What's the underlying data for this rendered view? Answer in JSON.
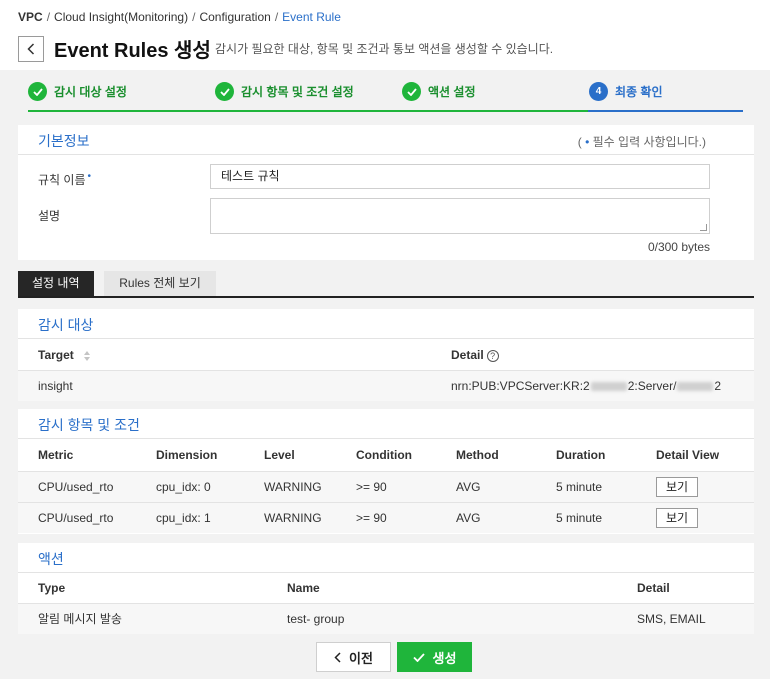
{
  "breadcrumb": {
    "items": [
      "VPC",
      "Cloud Insight(Monitoring)",
      "Configuration",
      "Event Rule"
    ],
    "separator": "/"
  },
  "header": {
    "title": "Event Rules 생성",
    "description": "감시가 필요한 대상, 항목 및 조건과 통보 액션을 생성할 수 있습니다."
  },
  "steps": [
    {
      "label": "감시 대상 설정",
      "state": "done"
    },
    {
      "label": "감시 항목 및 조건 설정",
      "state": "done"
    },
    {
      "label": "액션 설정",
      "state": "done"
    },
    {
      "label": "최종 확인",
      "state": "current",
      "number": "4"
    }
  ],
  "basic_info": {
    "title": "기본정보",
    "required_note_open": "(",
    "required_note_dot": "•",
    "required_note_text": "필수 입력 사항입니다.)",
    "name_label": "규칙 이름",
    "required_marker": "•",
    "name_value": "테스트 규칙",
    "desc_label": "설명",
    "desc_value": "",
    "byte_count": "0/300 bytes"
  },
  "tabs": {
    "settings": "설정 내역",
    "all_rules": "Rules 전체 보기"
  },
  "target_section": {
    "title": "감시 대상",
    "headers": {
      "target": "Target",
      "detail": "Detail"
    },
    "help_glyph": "?",
    "rows": [
      {
        "target": "insight",
        "detail_prefix": "nrn:PUB:VPCServer:KR:2",
        "detail_mid": "2:Server/",
        "detail_suffix": "2"
      }
    ]
  },
  "metric_section": {
    "title": "감시 항목 및 조건",
    "headers": [
      "Metric",
      "Dimension",
      "Level",
      "Condition",
      "Method",
      "Duration",
      "Detail View"
    ],
    "rows": [
      {
        "metric": "CPU/used_rto",
        "dimension": "cpu_idx: 0",
        "level": "WARNING",
        "condition": ">= 90",
        "method": "AVG",
        "duration": "5 minute",
        "view": "보기"
      },
      {
        "metric": "CPU/used_rto",
        "dimension": "cpu_idx: 1",
        "level": "WARNING",
        "condition": ">= 90",
        "method": "AVG",
        "duration": "5 minute",
        "view": "보기"
      }
    ]
  },
  "action_section": {
    "title": "액션",
    "headers": {
      "type": "Type",
      "name": "Name",
      "detail": "Detail"
    },
    "rows": [
      {
        "type": "알림 메시지 발송",
        "name": "test- group",
        "detail": "SMS, EMAIL"
      }
    ]
  },
  "buttons": {
    "prev": "이전",
    "create": "생성"
  },
  "colors": {
    "accent_blue": "#2a6fc9",
    "success_green": "#1fb53b",
    "dark_tab": "#262626"
  }
}
